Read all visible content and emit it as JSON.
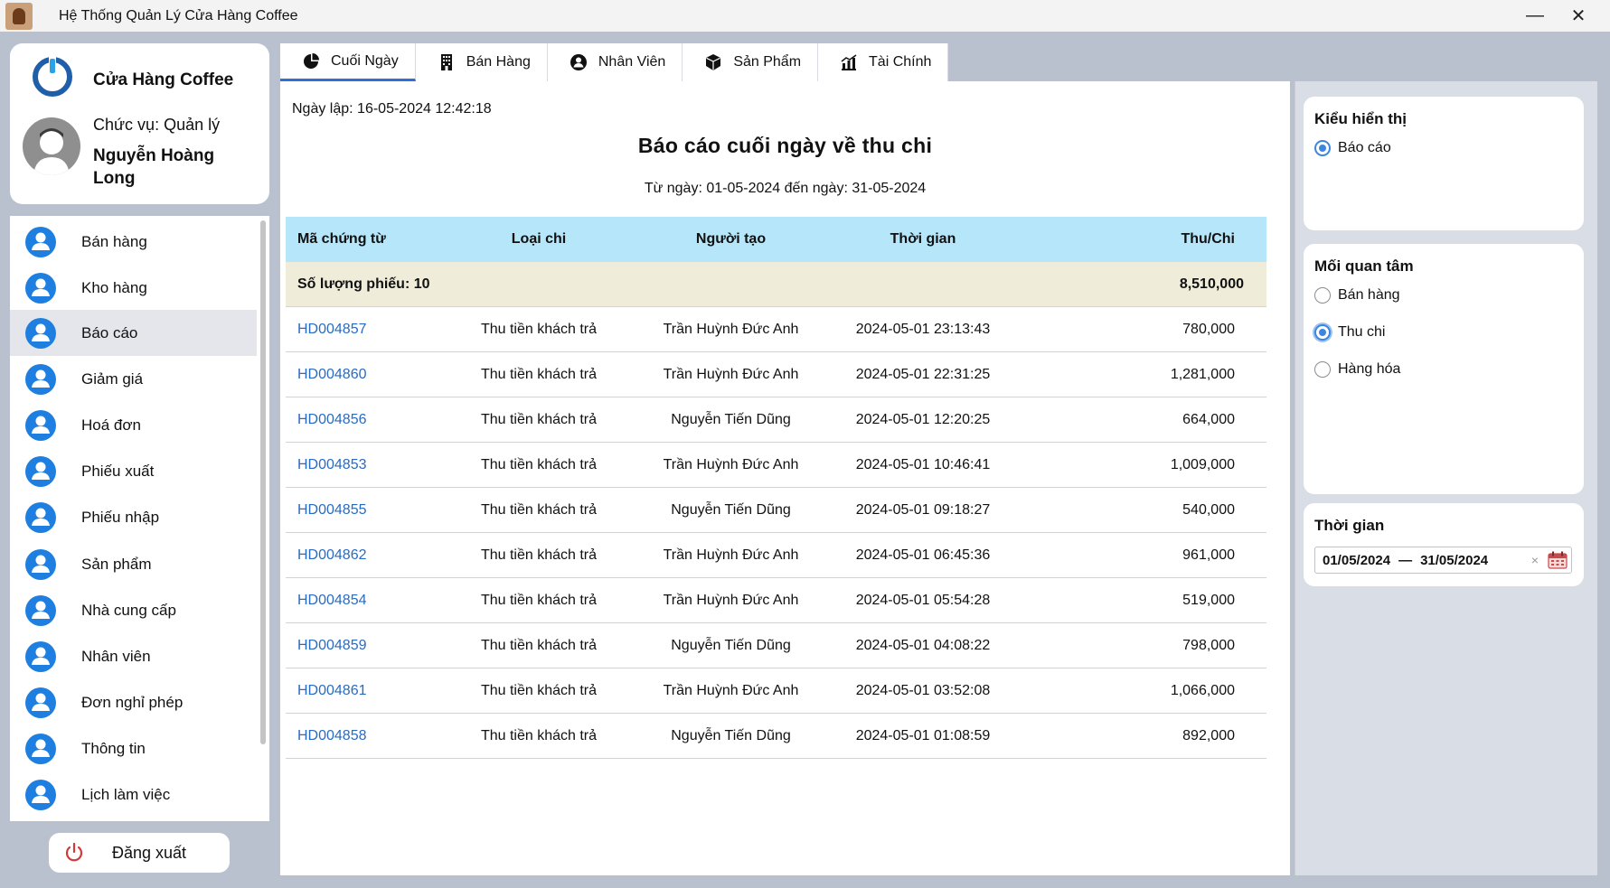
{
  "window": {
    "title": "Hệ Thống Quản Lý Cửa Hàng Coffee",
    "minimize_glyph": "—",
    "close_glyph": "✕"
  },
  "profile": {
    "shop_name": "Cửa Hàng Coffee",
    "role": "Chức vụ: Quản lý",
    "user_name": "Nguyễn Hoàng Long"
  },
  "sidebar": {
    "items": [
      {
        "label": "Bán hàng"
      },
      {
        "label": "Kho hàng"
      },
      {
        "label": "Báo cáo"
      },
      {
        "label": "Giảm giá"
      },
      {
        "label": "Hoá đơn"
      },
      {
        "label": "Phiếu xuất"
      },
      {
        "label": "Phiếu nhập"
      },
      {
        "label": "Sản phẩm"
      },
      {
        "label": "Nhà cung cấp"
      },
      {
        "label": "Nhân viên"
      },
      {
        "label": "Đơn nghỉ phép"
      },
      {
        "label": "Thông tin"
      },
      {
        "label": "Lịch làm việc"
      }
    ],
    "active_index": 2,
    "logout_label": "Đăng xuất"
  },
  "tabs": [
    {
      "label": "Cuối Ngày",
      "icon": "pie-chart-icon"
    },
    {
      "label": "Bán Hàng",
      "icon": "building-icon"
    },
    {
      "label": "Nhân Viên",
      "icon": "person-icon"
    },
    {
      "label": "Sản Phẩm",
      "icon": "box-icon"
    },
    {
      "label": "Tài Chính",
      "icon": "finance-chart-icon"
    }
  ],
  "report": {
    "created": "Ngày lập: 16-05-2024 12:42:18",
    "title": "Báo cáo cuối ngày về thu chi",
    "range": "Từ ngày: 01-05-2024 đến ngày: 31-05-2024",
    "columns": [
      "Mã chứng từ",
      "Loại chi",
      "Người tạo",
      "Thời gian",
      "Thu/Chi"
    ],
    "summary": {
      "label": "Số lượng phiếu: 10",
      "total": "8,510,000"
    },
    "rows": [
      {
        "code": "HD004857",
        "type": "Thu tiền khách trả",
        "creator": "Trần Huỳnh Đức Anh",
        "time": "2024-05-01 23:13:43",
        "amount": "780,000"
      },
      {
        "code": "HD004860",
        "type": "Thu tiền khách trả",
        "creator": "Trần Huỳnh Đức Anh",
        "time": "2024-05-01 22:31:25",
        "amount": "1,281,000"
      },
      {
        "code": "HD004856",
        "type": "Thu tiền khách trả",
        "creator": "Nguyễn Tiến Dũng",
        "time": "2024-05-01 12:20:25",
        "amount": "664,000"
      },
      {
        "code": "HD004853",
        "type": "Thu tiền khách trả",
        "creator": "Trần Huỳnh Đức Anh",
        "time": "2024-05-01 10:46:41",
        "amount": "1,009,000"
      },
      {
        "code": "HD004855",
        "type": "Thu tiền khách trả",
        "creator": "Nguyễn Tiến Dũng",
        "time": "2024-05-01 09:18:27",
        "amount": "540,000"
      },
      {
        "code": "HD004862",
        "type": "Thu tiền khách trả",
        "creator": "Trần Huỳnh Đức Anh",
        "time": "2024-05-01 06:45:36",
        "amount": "961,000"
      },
      {
        "code": "HD004854",
        "type": "Thu tiền khách trả",
        "creator": "Trần Huỳnh Đức Anh",
        "time": "2024-05-01 05:54:28",
        "amount": "519,000"
      },
      {
        "code": "HD004859",
        "type": "Thu tiền khách trả",
        "creator": "Nguyễn Tiến Dũng",
        "time": "2024-05-01 04:08:22",
        "amount": "798,000"
      },
      {
        "code": "HD004861",
        "type": "Thu tiền khách trả",
        "creator": "Trần Huỳnh Đức Anh",
        "time": "2024-05-01 03:52:08",
        "amount": "1,066,000"
      },
      {
        "code": "HD004858",
        "type": "Thu tiền khách trả",
        "creator": "Nguyễn Tiến Dũng",
        "time": "2024-05-01 01:08:59",
        "amount": "892,000"
      }
    ]
  },
  "options": {
    "display": {
      "title": "Kiểu hiển thị",
      "options": [
        "Báo cáo"
      ],
      "selected": "Báo cáo"
    },
    "interest": {
      "title": "Mối quan tâm",
      "options": [
        "Bán hàng",
        "Thu chi",
        "Hàng hóa"
      ],
      "selected": "Thu chi"
    },
    "time": {
      "title": "Thời gian",
      "from": "01/05/2024",
      "separator": "—",
      "to": "31/05/2024",
      "clear": "×"
    }
  },
  "colors": {
    "accent": "#2f6fd6",
    "nav_icon": "#1e7fe0",
    "link": "#2a6bc2",
    "table_header": "#b5e6fa",
    "summary_row": "#efecda",
    "logout_icon": "#d23a3a"
  }
}
